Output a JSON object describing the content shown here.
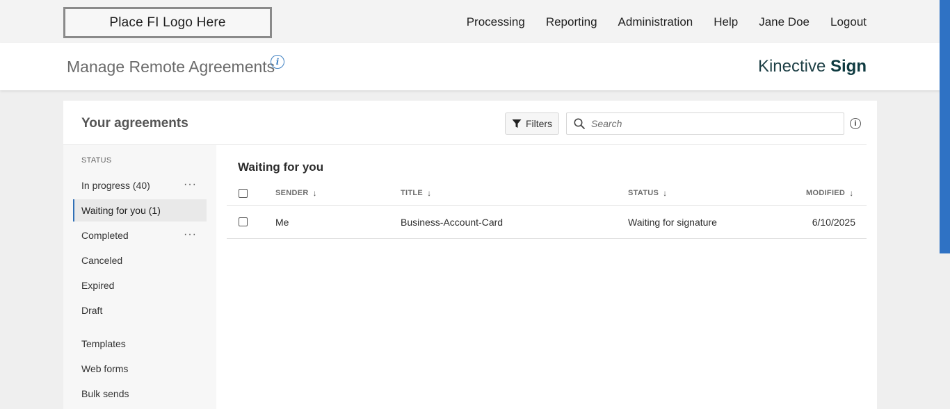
{
  "topbar": {
    "logo_text": "Place FI Logo Here",
    "nav": [
      "Processing",
      "Reporting",
      "Administration",
      "Help",
      "Jane Doe",
      "Logout"
    ]
  },
  "header": {
    "title": "Manage Remote Agreements",
    "info_icon": "i",
    "brand_light": "Kinective",
    "brand_bold": "Sign"
  },
  "card": {
    "title": "Your agreements",
    "filters_label": "Filters",
    "search_placeholder": "Search"
  },
  "sidebar": {
    "heading": "STATUS",
    "items": [
      {
        "label": "In progress (40)",
        "has_menu": true
      },
      {
        "label": "Waiting for you (1)",
        "active": true
      },
      {
        "label": "Completed",
        "has_menu": true
      },
      {
        "label": "Canceled"
      },
      {
        "label": "Expired"
      },
      {
        "label": "Draft"
      },
      {
        "label": "Templates"
      },
      {
        "label": "Web forms"
      },
      {
        "label": "Bulk sends"
      }
    ]
  },
  "table": {
    "section_title": "Waiting for you",
    "columns": [
      "SENDER",
      "TITLE",
      "STATUS",
      "MODIFIED"
    ],
    "rows": [
      {
        "sender": "Me",
        "title": "Business-Account-Card",
        "status": "Waiting for signature",
        "modified": "6/10/2025"
      }
    ]
  },
  "colors": {
    "accent_blue": "#2f72c4",
    "brand_teal": "#0e3a40"
  }
}
